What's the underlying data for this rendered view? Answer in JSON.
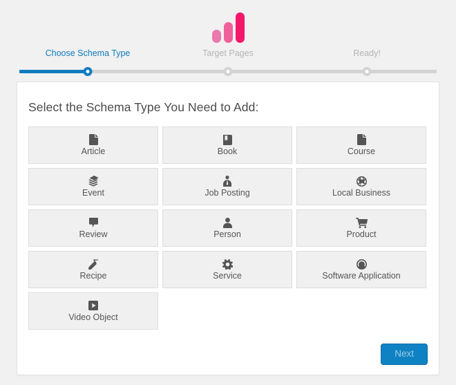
{
  "logo": {
    "name": "brand-logo",
    "bars": [
      {
        "color": "#e87aad",
        "height": 19
      },
      {
        "color": "#f0609a",
        "height": 30
      },
      {
        "color": "#f4186b",
        "height": 44
      }
    ]
  },
  "stepper": {
    "active_index": 0,
    "steps": [
      {
        "label": "Choose Schema Type",
        "state": "active"
      },
      {
        "label": "Target Pages",
        "state": "upcoming"
      },
      {
        "label": "Ready!",
        "state": "upcoming"
      }
    ],
    "active_color": "#0f7bbf",
    "inactive_color": "#d3d3d3"
  },
  "card": {
    "title": "Select the Schema Type You Need to Add:",
    "tiles": [
      {
        "label": "Article",
        "icon": "file-icon"
      },
      {
        "label": "Book",
        "icon": "book-icon"
      },
      {
        "label": "Course",
        "icon": "file-icon"
      },
      {
        "label": "Event",
        "icon": "calendar-stack-icon"
      },
      {
        "label": "Job Posting",
        "icon": "user-tie-icon"
      },
      {
        "label": "Local Business",
        "icon": "globe-icon"
      },
      {
        "label": "Review",
        "icon": "speech-bubble-icon"
      },
      {
        "label": "Person",
        "icon": "user-icon"
      },
      {
        "label": "Product",
        "icon": "shopping-cart-icon"
      },
      {
        "label": "Recipe",
        "icon": "carrot-icon"
      },
      {
        "label": "Service",
        "icon": "gear-icon"
      },
      {
        "label": "Software Application",
        "icon": "dashboard-icon"
      },
      {
        "label": "Video Object",
        "icon": "play-square-icon"
      }
    ],
    "next_label": "Next",
    "next_color": "#0f82c4"
  }
}
